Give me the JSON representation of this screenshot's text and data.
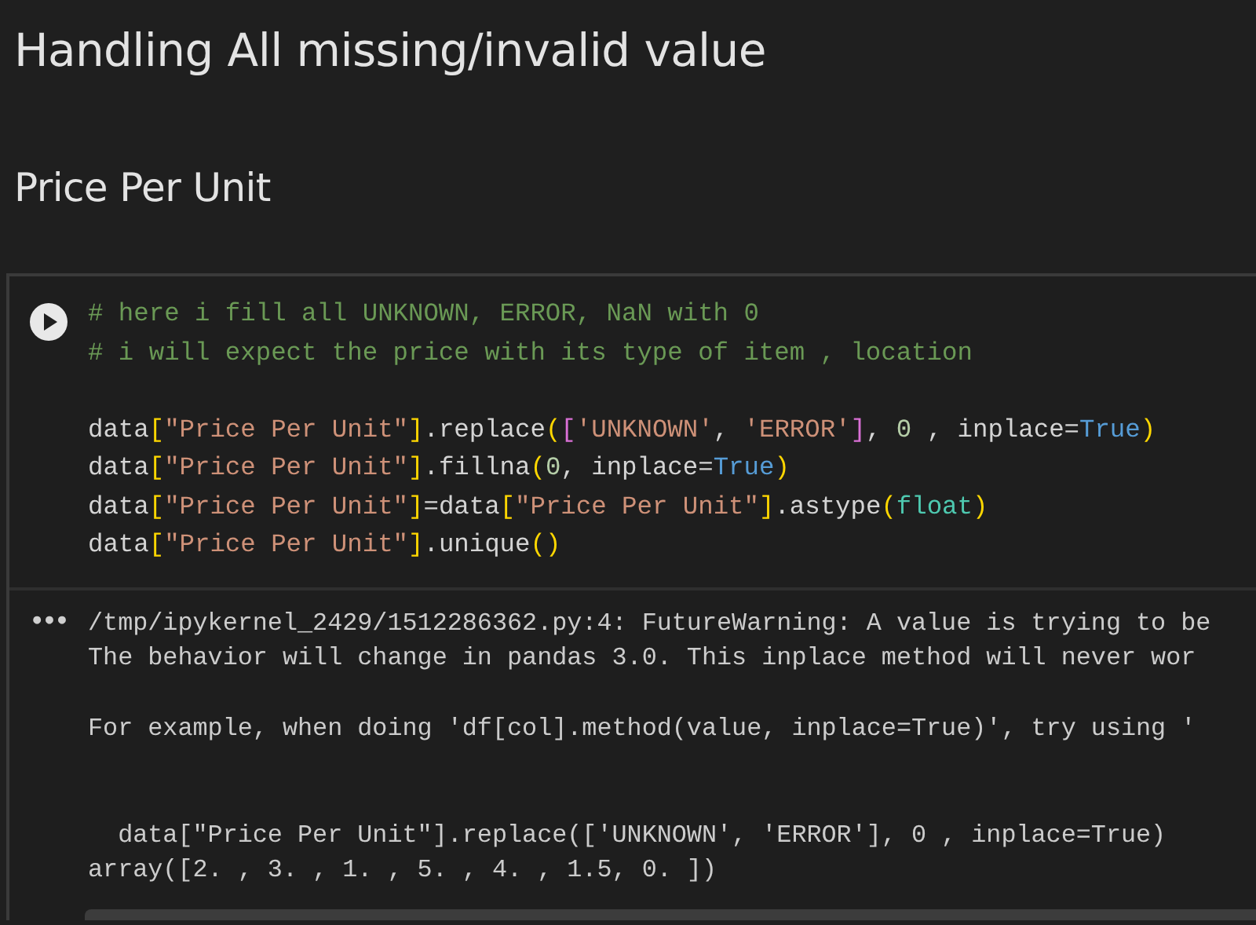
{
  "headings": [
    {
      "text": "Handling All missing/invalid value",
      "kind": "title"
    },
    {
      "text": "Price Per Unit",
      "kind": "section"
    }
  ],
  "cell": {
    "comment_lines": [
      [
        {
          "kind": "comment",
          "text": "# here i fill all UNKNOWN, ERROR, NaN with 0"
        }
      ],
      [
        {
          "kind": "comment",
          "text": "# i will expect the price with its type of item , location"
        }
      ]
    ],
    "statement_lines": [
      [
        {
          "kind": "plain",
          "text": "data"
        },
        {
          "kind": "bracket",
          "text": "["
        },
        {
          "kind": "string",
          "text": "\"Price Per Unit\""
        },
        {
          "kind": "bracket",
          "text": "]"
        },
        {
          "kind": "plain",
          "text": ".replace"
        },
        {
          "kind": "bracket",
          "text": "("
        },
        {
          "kind": "bracket2",
          "text": "["
        },
        {
          "kind": "string",
          "text": "'UNKNOWN'"
        },
        {
          "kind": "plain",
          "text": ", "
        },
        {
          "kind": "string",
          "text": "'ERROR'"
        },
        {
          "kind": "bracket2",
          "text": "]"
        },
        {
          "kind": "plain",
          "text": ", "
        },
        {
          "kind": "number",
          "text": "0"
        },
        {
          "kind": "plain",
          "text": " , inplace="
        },
        {
          "kind": "keyword",
          "text": "True"
        },
        {
          "kind": "bracket",
          "text": ")"
        }
      ],
      [
        {
          "kind": "plain",
          "text": "data"
        },
        {
          "kind": "bracket",
          "text": "["
        },
        {
          "kind": "string",
          "text": "\"Price Per Unit\""
        },
        {
          "kind": "bracket",
          "text": "]"
        },
        {
          "kind": "plain",
          "text": ".fillna"
        },
        {
          "kind": "bracket",
          "text": "("
        },
        {
          "kind": "number",
          "text": "0"
        },
        {
          "kind": "plain",
          "text": ", inplace="
        },
        {
          "kind": "keyword",
          "text": "True"
        },
        {
          "kind": "bracket",
          "text": ")"
        }
      ],
      [
        {
          "kind": "plain",
          "text": "data"
        },
        {
          "kind": "bracket",
          "text": "["
        },
        {
          "kind": "string",
          "text": "\"Price Per Unit\""
        },
        {
          "kind": "bracket",
          "text": "]"
        },
        {
          "kind": "plain",
          "text": "=data"
        },
        {
          "kind": "bracket",
          "text": "["
        },
        {
          "kind": "string",
          "text": "\"Price Per Unit\""
        },
        {
          "kind": "bracket",
          "text": "]"
        },
        {
          "kind": "plain",
          "text": ".astype"
        },
        {
          "kind": "bracket",
          "text": "("
        },
        {
          "kind": "builtin",
          "text": "float"
        },
        {
          "kind": "bracket",
          "text": ")"
        }
      ],
      [
        {
          "kind": "plain",
          "text": "data"
        },
        {
          "kind": "bracket",
          "text": "["
        },
        {
          "kind": "string",
          "text": "\"Price Per Unit\""
        },
        {
          "kind": "bracket",
          "text": "]"
        },
        {
          "kind": "plain",
          "text": ".unique"
        },
        {
          "kind": "bracket",
          "text": "()"
        }
      ]
    ],
    "output_menu": "•••",
    "output": {
      "warning_lines": [
        "/tmp/ipykernel_2429/1512286362.py:4: FutureWarning: A value is trying to be",
        "The behavior will change in pandas 3.0. This inplace method will never wor"
      ],
      "hint": "For example, when doing 'df[col].method(value, inplace=True)', try using '",
      "source_line": "  data[\"Price Per Unit\"].replace(['UNKNOWN', 'ERROR'], 0 , inplace=True)",
      "result": "array([2. , 3. , 1. , 5. , 4. , 1.5, 0. ])"
    }
  }
}
